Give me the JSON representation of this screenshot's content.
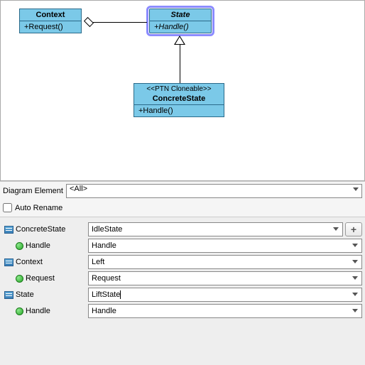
{
  "diagram": {
    "context": {
      "title": "Context",
      "op": "+Request()"
    },
    "state": {
      "title": "State",
      "op": "+Handle()"
    },
    "concrete": {
      "stereo": "<<PTN Cloneable>>",
      "title": "ConcreteState",
      "op": "+Handle()"
    }
  },
  "filter": {
    "label": "Diagram Element",
    "value": "<All>"
  },
  "autoRename": "Auto Rename",
  "props": [
    {
      "label": "ConcreteState",
      "value": "IdleState",
      "icon": "class",
      "plus": true
    },
    {
      "label": "Handle",
      "value": "Handle",
      "icon": "method",
      "child": true
    },
    {
      "label": "Context",
      "value": "Left",
      "icon": "class"
    },
    {
      "label": "Request",
      "value": "Request",
      "icon": "method",
      "child": true
    },
    {
      "label": "State",
      "value": "LiftState",
      "icon": "class",
      "cursor": true
    },
    {
      "label": "Handle",
      "value": "Handle",
      "icon": "method",
      "child": true
    }
  ]
}
